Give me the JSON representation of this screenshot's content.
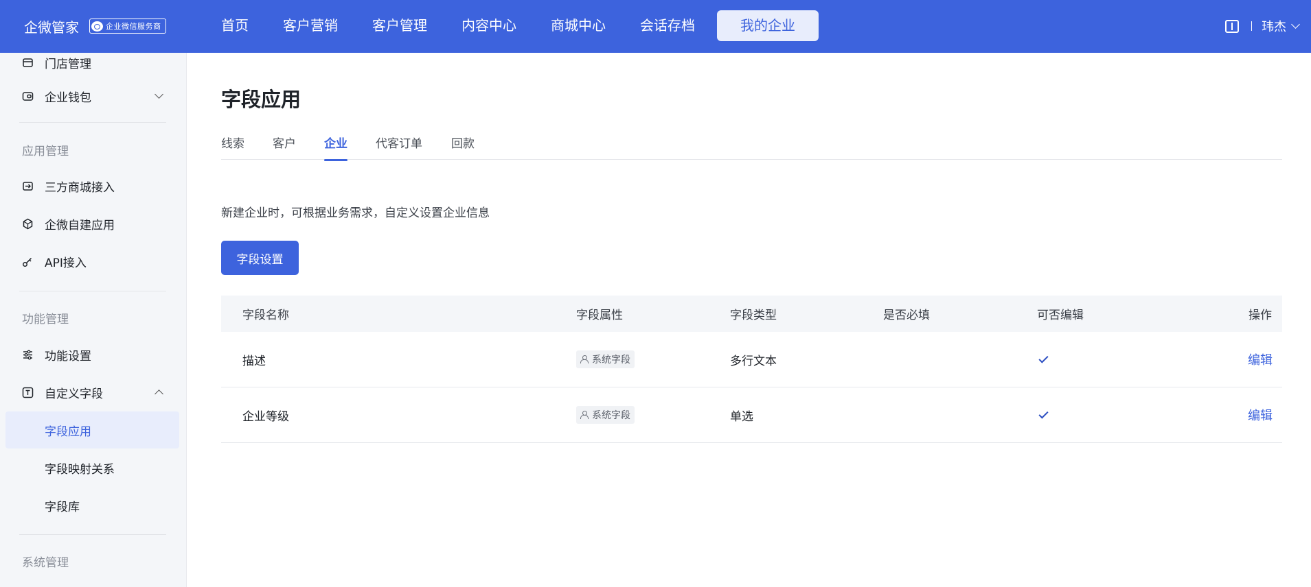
{
  "topbar": {
    "brand": "企微管家",
    "brand_badge": "企业微信服务商",
    "nav": [
      "首页",
      "客户营销",
      "客户管理",
      "内容中心",
      "商城中心",
      "会话存档",
      "我的企业"
    ],
    "active_nav": "我的企业",
    "user": "玮杰"
  },
  "sidebar": {
    "items_top": [
      {
        "label": "门店管理",
        "icon": "store-icon"
      },
      {
        "label": "企业钱包",
        "icon": "wallet-icon",
        "expandable": true
      }
    ],
    "group_app": "应用管理",
    "items_app": [
      {
        "label": "三方商城接入",
        "icon": "shop-connect-icon"
      },
      {
        "label": "企微自建应用",
        "icon": "cube-icon"
      },
      {
        "label": "API接入",
        "icon": "key-icon"
      }
    ],
    "group_func": "功能管理",
    "items_func": [
      {
        "label": "功能设置",
        "icon": "sliders-icon"
      },
      {
        "label": "自定义字段",
        "icon": "text-field-icon",
        "expanded": true
      }
    ],
    "sub_items": [
      "字段应用",
      "字段映射关系",
      "字段库"
    ],
    "selected": "字段应用",
    "group_sys": "系统管理"
  },
  "main": {
    "title": "字段应用",
    "tabs": [
      "线索",
      "客户",
      "企业",
      "代客订单",
      "回款"
    ],
    "active_tab": "企业",
    "description": "新建企业时，可根据业务需求，自定义设置企业信息",
    "button": "字段设置",
    "table": {
      "headers": [
        "字段名称",
        "字段属性",
        "字段类型",
        "是否必填",
        "可否编辑",
        "操作"
      ],
      "rows": [
        {
          "name": "描述",
          "attr": "系统字段",
          "type": "多行文本",
          "required": false,
          "editable": true,
          "action": "编辑"
        },
        {
          "name": "企业等级",
          "attr": "系统字段",
          "type": "单选",
          "required": false,
          "editable": true,
          "action": "编辑"
        }
      ]
    }
  },
  "colors": {
    "accent": "#3d63dd",
    "sidebar_bg": "#f4f6f9",
    "selected_bg": "#e8edfc"
  }
}
